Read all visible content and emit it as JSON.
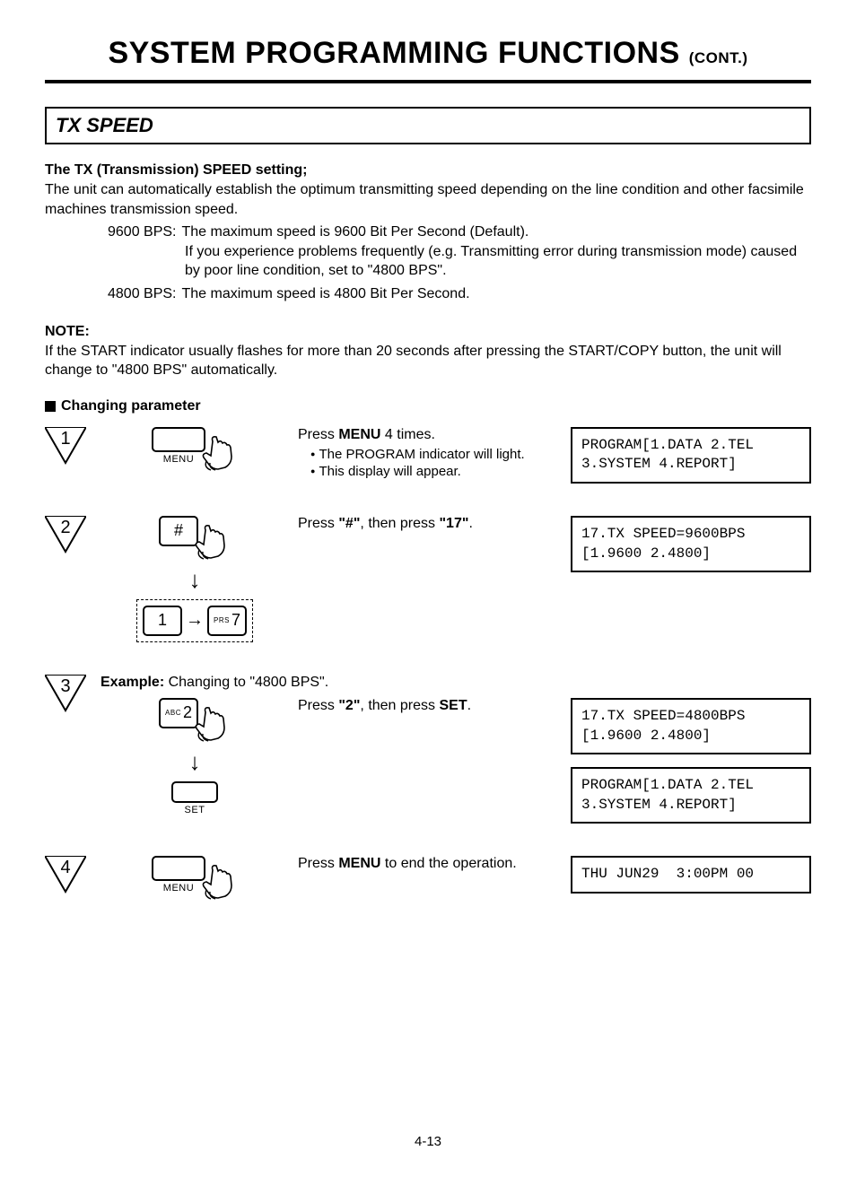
{
  "title_main": "SYSTEM PROGRAMMING FUNCTIONS ",
  "title_cont": "(CONT.)",
  "section_title": "TX SPEED",
  "sub1": "The TX (Transmission) SPEED setting;",
  "p1": "The unit can automatically establish the optimum transmitting speed depending on the line condition and other facsimile machines transmission speed.",
  "bps1_label": "9600 BPS:",
  "bps1_l1": "The maximum speed is 9600 Bit Per Second (Default).",
  "bps1_l2": "If you experience problems frequently (e.g. Transmitting error during transmission mode) caused by poor line condition, set to \"4800 BPS\".",
  "bps2_label": "4800 BPS:",
  "bps2_l1": "The maximum speed is 4800 Bit Per Second.",
  "note_head": "NOTE:",
  "note_text": "If the START indicator usually flashes for more than 20 seconds after pressing the START/COPY button, the unit will change to \"4800 BPS\" automatically.",
  "changing": "Changing parameter",
  "steps": {
    "s1": {
      "num": "1",
      "instr_a": "Press ",
      "instr_b": "MENU",
      "instr_c": " 4 times.",
      "n1": "The PROGRAM indicator will light.",
      "n2": "This display will appear.",
      "key_label": "MENU",
      "lcd": "PROGRAM[1.DATA 2.TEL\n3.SYSTEM 4.REPORT]"
    },
    "s2": {
      "num": "2",
      "instr_a": "Press ",
      "instr_b": "\"#\"",
      "instr_c": ", then press ",
      "instr_d": "\"17\"",
      "instr_e": ".",
      "key_hash": "#",
      "key_1": "1",
      "key_7": "7",
      "key_7_pre": "PRS",
      "lcd": "17.TX SPEED=9600BPS\n[1.9600 2.4800]"
    },
    "s3": {
      "num": "3",
      "ex_a": "Example:",
      "ex_b": "  Changing to \"4800 BPS\".",
      "instr_a": "Press ",
      "instr_b": "\"2\"",
      "instr_c": ", then press ",
      "instr_d": "SET",
      "instr_e": ".",
      "key_2": "2",
      "key_2_pre": "ABC",
      "key_set": "SET",
      "lcd1": "17.TX SPEED=4800BPS\n[1.9600 2.4800]",
      "lcd2": "PROGRAM[1.DATA 2.TEL\n3.SYSTEM 4.REPORT]"
    },
    "s4": {
      "num": "4",
      "instr_a": "Press ",
      "instr_b": "MENU",
      "instr_c": " to end the operation.",
      "key_label": "MENU",
      "lcd": "THU JUN29  3:00PM 00"
    }
  },
  "page_num": "4-13"
}
